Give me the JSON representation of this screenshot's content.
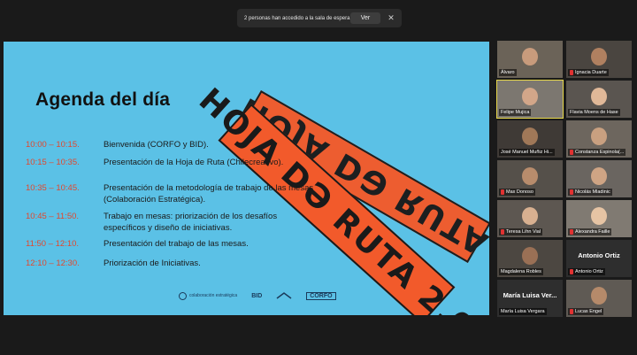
{
  "notification": {
    "text": "2 personas han accedido a la sala de espera",
    "view_label": "Ver",
    "close_label": "✕"
  },
  "slide": {
    "title": "Agenda del día",
    "banner_text": "HOJA DƏ RUTA 2.0",
    "banner_text_mirrored": "HOJA DƏ RUTA",
    "agenda": [
      {
        "time": "10:00 – 10:15.",
        "desc": "Bienvenida (CORFO y BID)."
      },
      {
        "time": "10:15 – 10:35.",
        "desc": "Presentación de la Hoja de Ruta (Chilecreativo)."
      },
      {
        "time": "10:35 – 10:45.",
        "desc": "Presentación de la metodología de trabajo de las mesas (Colaboración Estratégica)."
      },
      {
        "time": "10:45 – 11:50.",
        "desc": "Trabajo en mesas: priorización de los desafíos específicos y diseño de iniciativas."
      },
      {
        "time": "11:50 – 12:10.",
        "desc": "Presentación del trabajo de las mesas."
      },
      {
        "time": "12:10 – 12:30.",
        "desc": "Priorización de Iniciativas."
      }
    ],
    "logos": {
      "colab": "colaboración estratégica",
      "bid": "BID",
      "corfo": "CORFO"
    },
    "accent_color": "#e2472d",
    "background_color": "#5bc1e6"
  },
  "participants": [
    {
      "name": "Álvaro",
      "muted": false,
      "video": true
    },
    {
      "name": "Ignacia Duarte",
      "muted": true,
      "video": true
    },
    {
      "name": "Felipe Mujica",
      "muted": false,
      "video": true,
      "active": true
    },
    {
      "name": "Flavia Moens de Hase",
      "muted": false,
      "video": true
    },
    {
      "name": "José Manuel Muñiz Hi...",
      "muted": false,
      "video": true
    },
    {
      "name": "Constanza Espinola(...",
      "muted": true,
      "video": true
    },
    {
      "name": "Max Donoso",
      "muted": true,
      "video": true
    },
    {
      "name": "Nicolás Mladinic",
      "muted": true,
      "video": true
    },
    {
      "name": "Teresa Lihn Vial",
      "muted": true,
      "video": true
    },
    {
      "name": "Alexandra Faille",
      "muted": true,
      "video": true
    },
    {
      "name": "Magdalena Robles",
      "muted": false,
      "video": true
    },
    {
      "name": "Antonio Ortiz",
      "muted": true,
      "video": false,
      "display": "Antonio Ortiz"
    },
    {
      "name": "María Luisa Vergara",
      "muted": false,
      "video": false,
      "display": "María Luisa Ver..."
    },
    {
      "name": "Lucas Engel",
      "muted": true,
      "video": true
    }
  ]
}
